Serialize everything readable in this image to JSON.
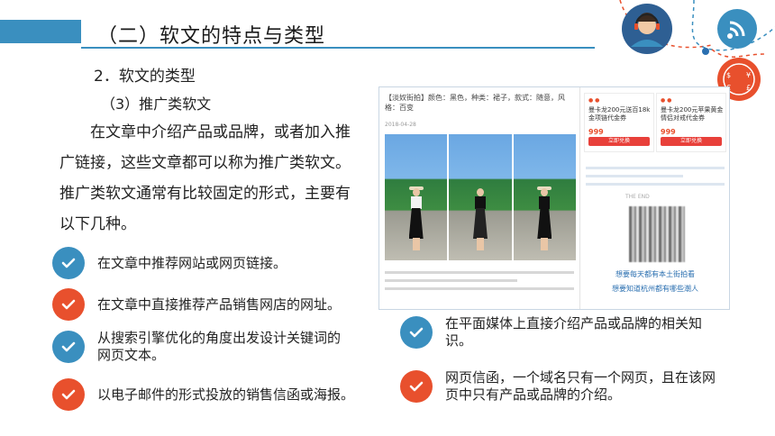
{
  "header": {
    "title": "（二）软文的特点与类型"
  },
  "section": {
    "heading": "2．软文的类型",
    "subheading": "（3）推广类软文"
  },
  "intro": "在文章中介绍产品或品牌，或者加入推广链接，这些文章都可以称为推广类软文。推广类软文通常有比较固定的形式，主要有以下几种。",
  "list": [
    {
      "text": "在文章中推荐网站或网页链接。",
      "color": "#3a8fbf"
    },
    {
      "text": "在文章中直接推荐产品销售网店的网址。",
      "color": "#e8502d"
    },
    {
      "text": "从搜索引擎优化的角度出发设计关键词的网页文本。",
      "color": "#3a8fbf"
    },
    {
      "text": "以电子邮件的形式投放的销售信函或海报。",
      "color": "#e8502d"
    },
    {
      "text": "在平面媒体上直接介绍产品或品牌的相关知识。",
      "color": "#3a8fbf"
    },
    {
      "text": "网页信函，一个域名只有一个网页，且在该网页中只有产品或品牌的介绍。",
      "color": "#e8502d"
    }
  ],
  "screenshot": {
    "article_title": "【淡奴街拍】颜色：黑色，种类：裙子，款式：随意，风格：百变",
    "article_meta": "2018-04-28",
    "cards": [
      {
        "desc": "曼卡龙200元送百18k金项链代金券",
        "price": "999",
        "buy": "立即兑换"
      },
      {
        "desc": "曼卡龙200元苹果黄金情侣对戒代金券",
        "price": "999",
        "buy": "立即兑换"
      }
    ],
    "end_marker": "THE END",
    "follow_1": "想要每天都有本土街拍看",
    "follow_2": "想要知道杭州都有哪些潮人"
  },
  "colors": {
    "accent_blue": "#3a8fbf",
    "accent_red": "#e8502d"
  },
  "icons": {
    "check": "check-icon",
    "support": "customer-support-icon",
    "wifi": "wifi-icon",
    "currency": "currency-exchange-icon"
  }
}
